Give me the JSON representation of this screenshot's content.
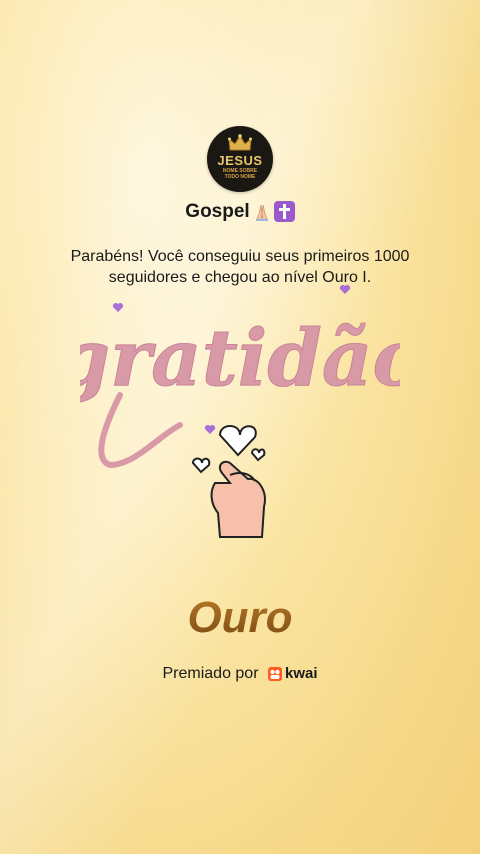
{
  "profile": {
    "avatar_title": "JESUS",
    "avatar_subtitle_1": "NOME SOBRE",
    "avatar_subtitle_2": "TODO NOME",
    "name": "Gospel",
    "name_emojis": [
      "folded-hands-icon",
      "latin-cross-icon"
    ]
  },
  "message": "Parabéns! Você conseguiu seus primeiros 1000 seguidores e chegou ao nível Ouro I.",
  "artwork": {
    "text": "gratidão",
    "icons": [
      "heart-icon",
      "finger-heart-hand-icon"
    ]
  },
  "level": "Ouro",
  "footer": {
    "awarded_by": "Premiado por",
    "brand": "kwai"
  },
  "colors": {
    "background": "#f6d98a",
    "level_text": "#8a5a14",
    "lettering": "#d99aa8",
    "accent_heart": "#9b59c9",
    "kwai": "#ff5a1f"
  }
}
